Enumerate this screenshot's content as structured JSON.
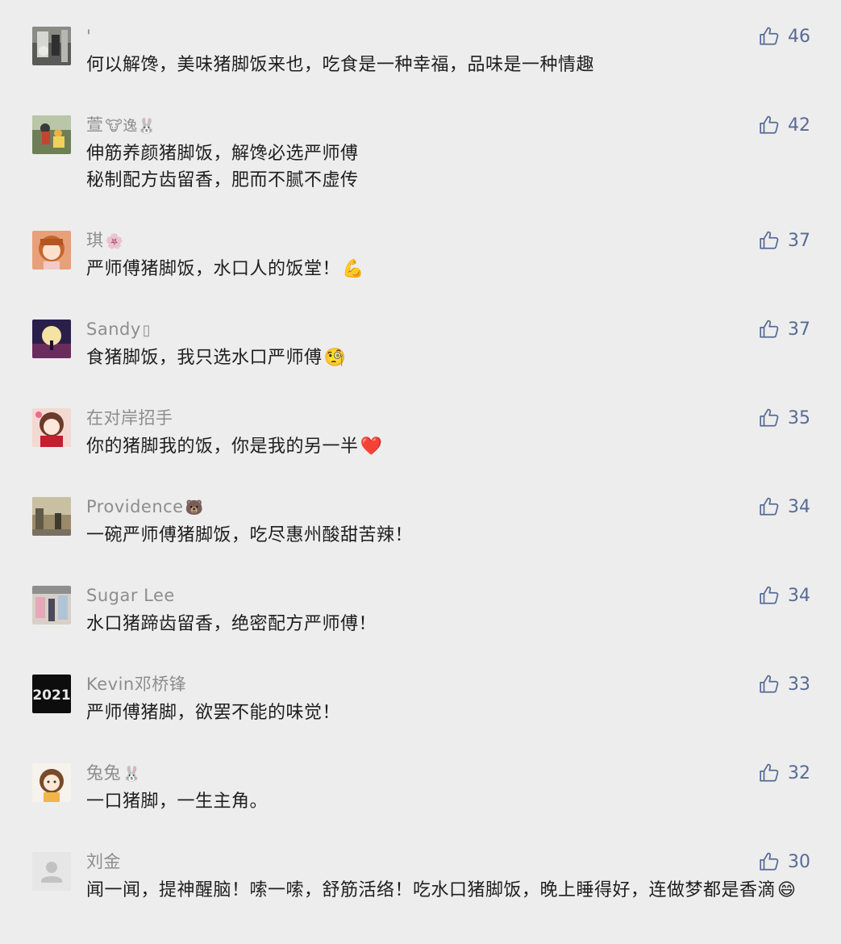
{
  "comments": [
    {
      "nickname": "'",
      "nick_emoji": "",
      "text": [
        "何以解馋，美味猪脚饭来也，吃食是一种幸福，品味是一种情趣"
      ],
      "text_emoji": "",
      "likes": "46",
      "avatar": "photo-dark"
    },
    {
      "nickname": "萱",
      "nick_emoji": "🐮逸🐰",
      "text": [
        "伸筋养颜猪脚饭，解馋必选严师傅",
        "秘制配方齿留香，肥而不腻不虚传"
      ],
      "text_emoji": "",
      "likes": "42",
      "avatar": "photo-park"
    },
    {
      "nickname": "琪",
      "nick_emoji": "🌸",
      "text": [
        "严师傅猪脚饭，水口人的饭堂！"
      ],
      "text_emoji": "💪",
      "likes": "37",
      "avatar": "anime-girl"
    },
    {
      "nickname": "Sandy",
      "nick_emoji": "▯",
      "text": [
        "食猪脚饭，我只选水口严师傅"
      ],
      "text_emoji": "🧐",
      "likes": "37",
      "avatar": "moon-night"
    },
    {
      "nickname": "在对岸招手",
      "nick_emoji": "",
      "text": [
        "你的猪脚我的饭，你是我的另一半"
      ],
      "text_emoji": "❤️",
      "likes": "35",
      "avatar": "anime-red"
    },
    {
      "nickname": "Providence",
      "nick_emoji": "🐻",
      "text": [
        "一碗严师傅猪脚饭，吃尽惠州酸甜苦辣！"
      ],
      "text_emoji": "",
      "likes": "34",
      "avatar": "photo-street"
    },
    {
      "nickname": "Sugar Lee",
      "nick_emoji": "",
      "text": [
        "水口猪蹄齿留香，绝密配方严师傅！"
      ],
      "text_emoji": "",
      "likes": "34",
      "avatar": "photo-shop"
    },
    {
      "nickname": "Kevin邓桥锋",
      "nick_emoji": "",
      "text": [
        "严师傅猪脚，欲罢不能的味觉！"
      ],
      "text_emoji": "",
      "likes": "33",
      "avatar": "year-2021"
    },
    {
      "nickname": "兔兔",
      "nick_emoji": "🐰",
      "text": [
        "一口猪脚，一生主角。"
      ],
      "text_emoji": "",
      "likes": "32",
      "avatar": "cartoon-girl"
    },
    {
      "nickname": "刘金",
      "nick_emoji": "",
      "text": [
        "闻一闻，提神醒脑！嗦一嗦，舒筋活络！吃水口猪脚饭，晚上睡得好，连做梦都是香滴"
      ],
      "text_emoji": "😄",
      "likes": "30",
      "avatar": "default-user"
    }
  ],
  "colors": {
    "background": "#ededed",
    "nickname": "#8d8d8d",
    "text": "#1e1e1e",
    "like": "#576b95"
  },
  "icons": {
    "like": "thumbs-up-outline-icon"
  }
}
